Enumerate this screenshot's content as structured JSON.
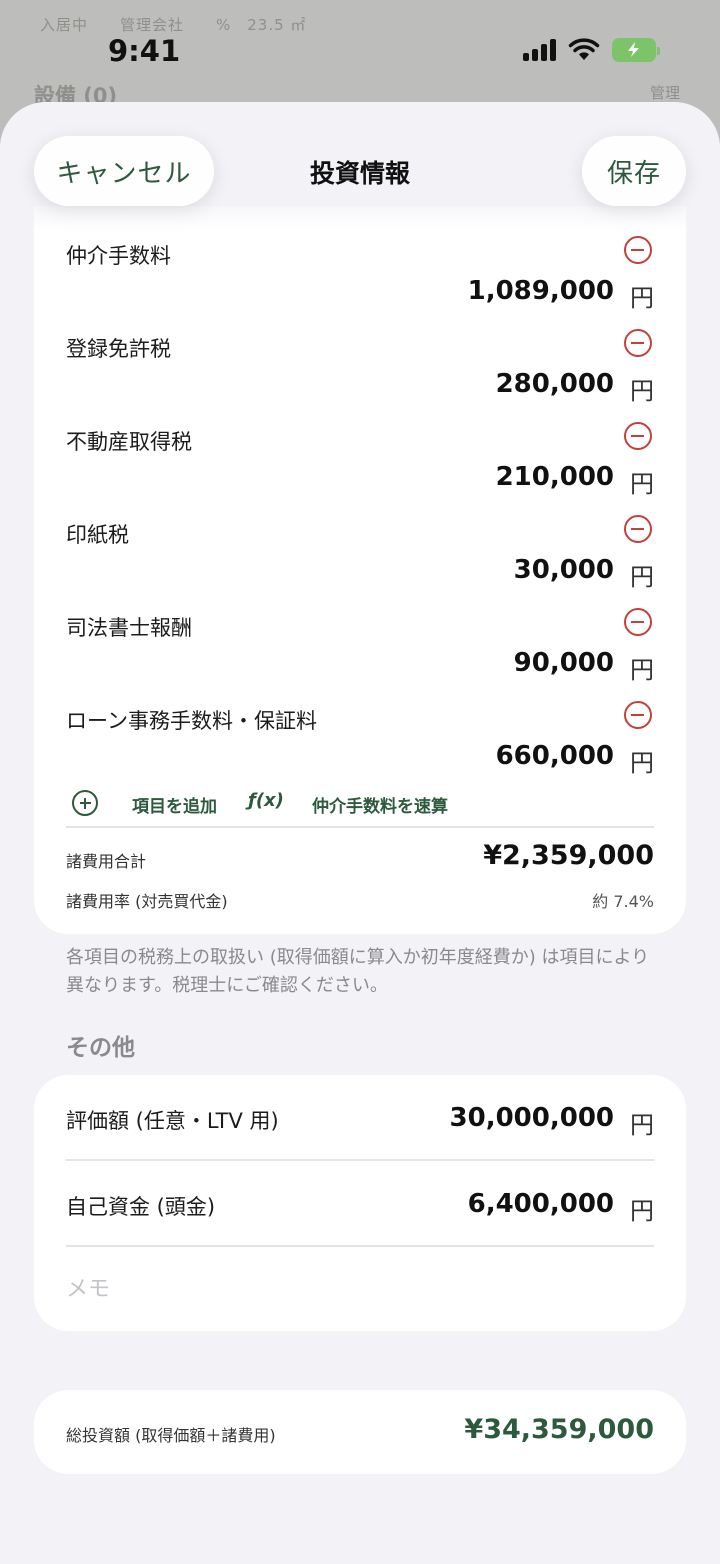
{
  "background": {
    "row1": "入居中　　管理会社　　%　23.5 ㎡",
    "row2": "設備 (0)",
    "right": "管理"
  },
  "status_bar": {
    "time": "9:41"
  },
  "nav": {
    "cancel": "キャンセル",
    "title": "投資情報",
    "save": "保存"
  },
  "expenses": {
    "items": [
      {
        "label": "仲介手数料",
        "amount": "1,089,000",
        "unit": "円"
      },
      {
        "label": "登録免許税",
        "amount": "280,000",
        "unit": "円"
      },
      {
        "label": "不動産取得税",
        "amount": "210,000",
        "unit": "円"
      },
      {
        "label": "印紙税",
        "amount": "30,000",
        "unit": "円"
      },
      {
        "label": "司法書士報酬",
        "amount": "90,000",
        "unit": "円"
      },
      {
        "label": "ローン事務手数料・保証料",
        "amount": "660,000",
        "unit": "円"
      }
    ],
    "add_item": "項目を追加",
    "fx": "ƒ(x)",
    "quick_calc": "仲介手数料を速算",
    "total_label": "諸費用合計",
    "total_value": "¥2,359,000",
    "rate_label": "諸費用率 (対売買代金)",
    "rate_value": "約 7.4%"
  },
  "note": "各項目の税務上の取扱い (取得価額に算入か初年度経費か) は項目により異なります。税理士にご確認ください。",
  "other": {
    "title": "その他",
    "rows": [
      {
        "label": "評価額 (任意・LTV 用)",
        "amount": "30,000,000",
        "unit": "円"
      },
      {
        "label": "自己資金 (頭金)",
        "amount": "6,400,000",
        "unit": "円"
      }
    ],
    "memo_placeholder": "メモ"
  },
  "total": {
    "label": "総投資額 (取得価額＋諸費用)",
    "value": "¥34,359,000"
  },
  "colors": {
    "accent": "#2d5a3d",
    "destructive": "#c2413a",
    "battery": "#7cc36a"
  }
}
